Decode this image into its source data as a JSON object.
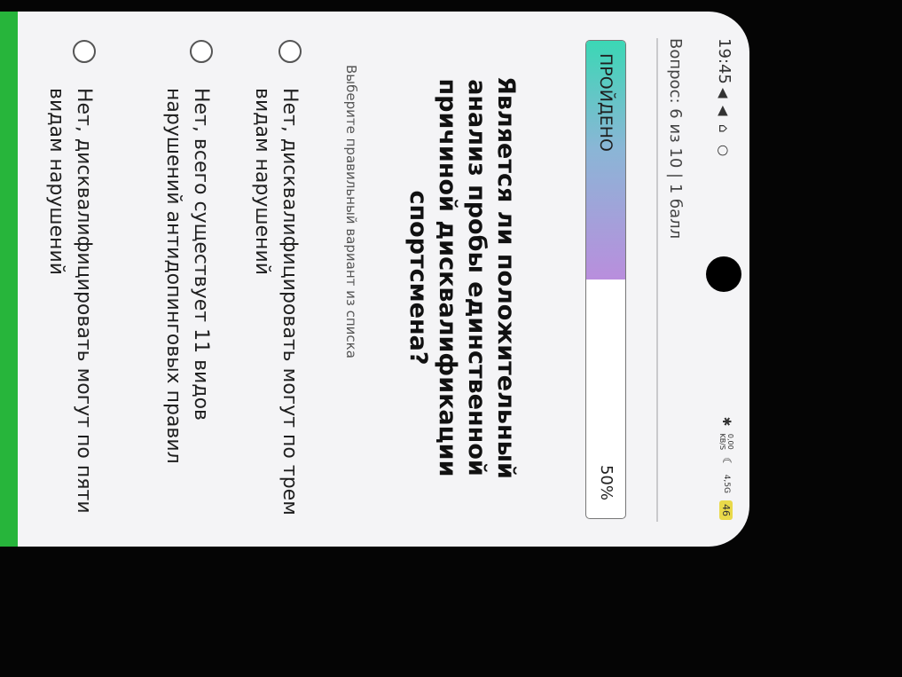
{
  "status_bar": {
    "time": "19:45",
    "speed_value": "0,00",
    "speed_unit": "KB/S",
    "network": "4,5G",
    "battery": "46"
  },
  "quiz": {
    "counter": "Вопрос: 6 из 10 | 1 балл",
    "progress_label": "ПРОЙДЕНО",
    "progress_value": "50%",
    "progress_fraction": 0.5,
    "question": "Является ли положительный анализ пробы единственной причиной дисквалификации спортсмена?",
    "hint": "Выберите правильный вариант из списка",
    "options": [
      "Нет, дисквалифицировать могут по трем видам нарушений",
      "Нет, всего существует 11 видов нарушений антидопинговых правил",
      "Нет, дисквалифицировать могут по пяти видам нарушений"
    ]
  },
  "colors": {
    "progress_start": "#3bd7b5",
    "progress_end": "#b98edd",
    "bottom_button": "#27b53b"
  }
}
